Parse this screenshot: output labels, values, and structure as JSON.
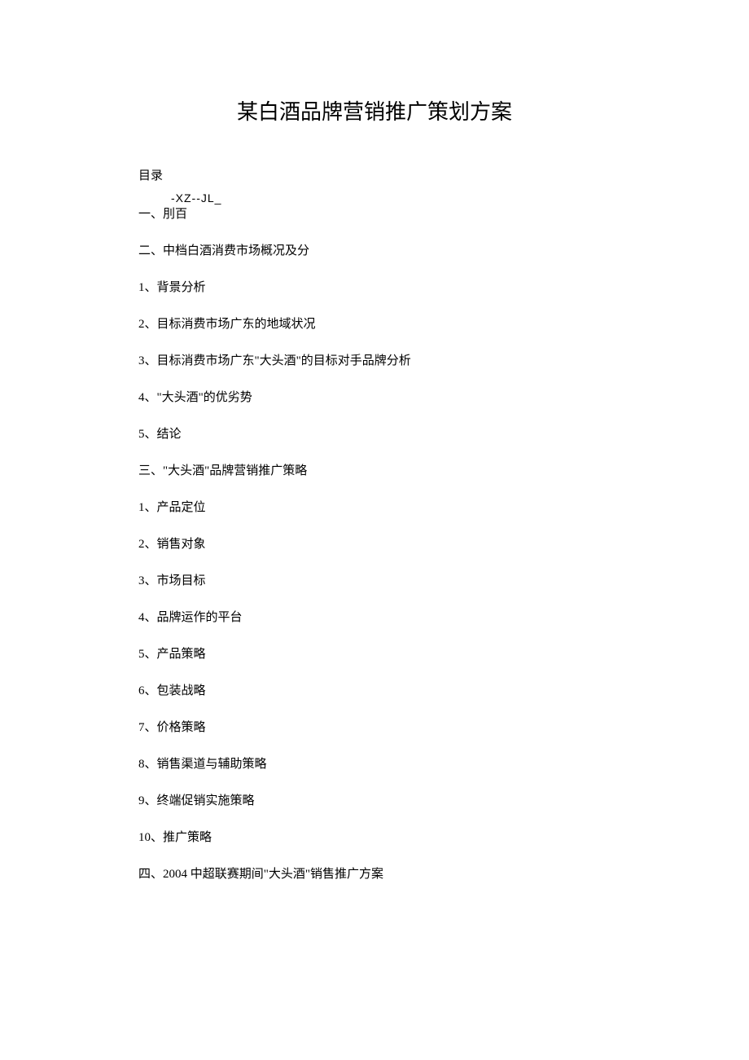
{
  "title": "某白酒品牌营销推广策划方案",
  "toc_label": "目录",
  "annotation": "-XZ--JL_",
  "items": [
    "一、刖百",
    "二、中档白酒消费市场概况及分",
    "1、背景分析",
    "2、目标消费市场广东的地域状况",
    "3、目标消费市场广东\"大头酒\"的目标对手品牌分析",
    "4、\"大头酒\"的优劣势",
    "5、结论",
    "三、\"大头酒\"品牌营销推广策略",
    "1、产品定位",
    "2、销售对象",
    "3、市场目标",
    "4、品牌运作的平台",
    "5、产品策略",
    "6、包装战略",
    "7、价格策略",
    "8、销售渠道与辅助策略",
    "9、终端促销实施策略",
    "10、推广策略",
    "四、2004 中超联赛期间\"大头酒\"销售推广方案"
  ]
}
